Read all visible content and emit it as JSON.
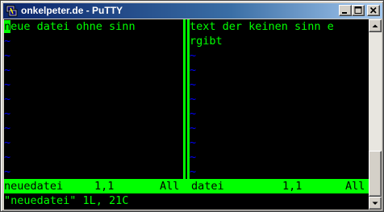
{
  "window": {
    "title": "onkelpeter.de - PuTTY",
    "icon": "putty-icon",
    "controls": [
      "minimize-icon",
      "maximize-icon",
      "close-icon"
    ]
  },
  "colors": {
    "terminal_background": "#000000",
    "text": "#00ff00",
    "tilde": "#0000ff",
    "statusline_background": "#00ff00",
    "titlebar": "#0a246a"
  },
  "left_pane": {
    "lines": [
      {
        "cursor_char": "n",
        "rest": "eue datei ohne sinn"
      }
    ],
    "tildes": [
      "~",
      "~",
      "~",
      "~",
      "~",
      "~",
      "~",
      "~",
      "~",
      "~"
    ]
  },
  "right_pane": {
    "lines": [
      "text der keinen sinn e",
      "rgibt"
    ],
    "tildes": [
      "~",
      "~",
      "~",
      "~",
      "~",
      "~",
      "~",
      "~",
      "~"
    ]
  },
  "statusline": {
    "left_name": "neuedatei",
    "left_pos": "1,1",
    "left_all": "All",
    "right_name": "datei",
    "right_pos": "1,1",
    "right_all": "All"
  },
  "cmdline": "\"neuedatei\" 1L, 21C"
}
